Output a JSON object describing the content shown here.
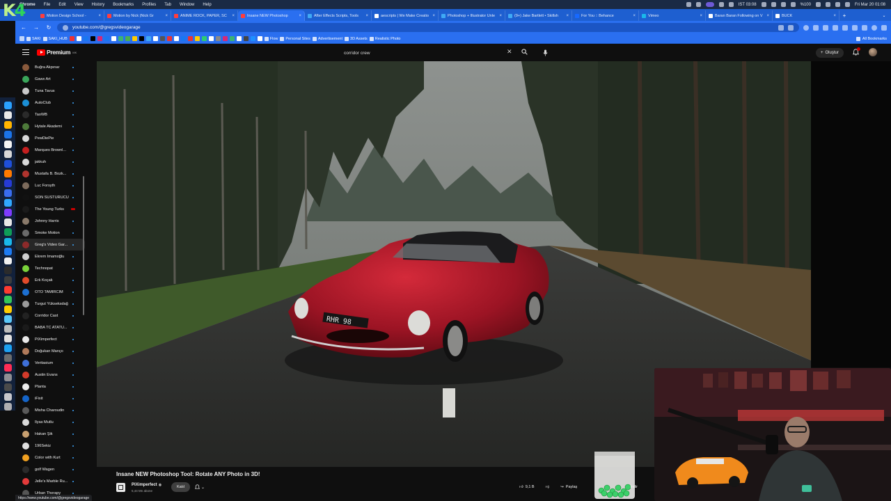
{
  "menubar": {
    "items": [
      "Chrome",
      "File",
      "Edit",
      "View",
      "History",
      "Bookmarks",
      "Profiles",
      "Tab",
      "Window",
      "Help"
    ],
    "status_left": "IST 03:08",
    "battery": "%100",
    "datetime": "Fri Mar 20  01:08"
  },
  "logo": {
    "text_k": "K",
    "text_4": "4"
  },
  "tabs": [
    {
      "title": "Motion Design School - ",
      "fav": "red"
    },
    {
      "title": "Motion by Nick (Nick Gr",
      "fav": "red"
    },
    {
      "title": "ANIME ROCK, PAPER, SC",
      "fav": "red"
    },
    {
      "title": "Insane NEW Photoshop",
      "fav": "red",
      "active": true
    },
    {
      "title": "After Effects Scripts, Tools",
      "fav": "globe"
    },
    {
      "title": "aescripts | We Make Creatio",
      "fav": "white"
    },
    {
      "title": "Photoshop + Illustrator Unle",
      "fav": "globe"
    },
    {
      "title": "(9+) Jake Bartlett • Skillsh",
      "fav": "globe"
    },
    {
      "title": "For You :: Behance",
      "fav": "behance"
    },
    {
      "title": "Vimeo",
      "fav": "vimeo"
    },
    {
      "title": "Baran Baran Following on V",
      "fav": "white"
    },
    {
      "title": "BUCK",
      "fav": "white"
    }
  ],
  "address": {
    "url": "youtube.com/@gregsvideogarage"
  },
  "bookmarks": {
    "items": [
      "SAKI",
      "SAKI_HUB",
      "Flow",
      "Personal Sites",
      "Advertisement",
      "3D Assets",
      "Realistic Photo"
    ],
    "all": "All Bookmarks"
  },
  "yt": {
    "logo_word": "Premium",
    "logo_sup": "MK",
    "search_query": "corridor crew",
    "create_label": "Oluştur"
  },
  "subscriptions": [
    {
      "name": "Buğra Akpınar",
      "color": "#8a5a3c"
    },
    {
      "name": "Gawx Art",
      "color": "#3aa55a"
    },
    {
      "name": "Tuna Tavus",
      "color": "#c9c9c9"
    },
    {
      "name": "AutoClub",
      "color": "#1b8fd6"
    },
    {
      "name": "TaoWB",
      "color": "#2a2a2a"
    },
    {
      "name": "Hytale Akademi",
      "color": "#4d7a3a"
    },
    {
      "name": "PewDiePie",
      "color": "#d8d8d8"
    },
    {
      "name": "Marques Brownl...",
      "color": "#c41f1f"
    },
    {
      "name": "jakkuh",
      "color": "#d8d8d8"
    },
    {
      "name": "Mustafa B. Bozk...",
      "color": "#b0342e"
    },
    {
      "name": "Luc Forsyth",
      "color": "#7d6b5c"
    },
    {
      "name": "SON SUSTURUCU",
      "color": "#111111"
    },
    {
      "name": "The Young Turks",
      "color": "#1a1a1a",
      "live": true
    },
    {
      "name": "Johnny Harris",
      "color": "#8a7a6a"
    },
    {
      "name": "Smoke Motion",
      "color": "#6a6a6a"
    },
    {
      "name": "Greg's Video Gar...",
      "color": "#8c2a2a",
      "hover": true
    },
    {
      "name": "Ekrem İmamoğlu",
      "color": "#cfcfcf"
    },
    {
      "name": "Technopat",
      "color": "#7ad23a"
    },
    {
      "name": "Erk Koçak",
      "color": "#e24b2a"
    },
    {
      "name": "OTO TAMIRCIM",
      "color": "#1c6fd1"
    },
    {
      "name": "Turgut Yükseksdağ",
      "color": "#9a9a9a"
    },
    {
      "name": "Corridor Cast",
      "color": "#222222"
    },
    {
      "name": "BABA TC ATATU...",
      "color": "#1a1a1a"
    },
    {
      "name": "PiXimperfect",
      "color": "#e8e8e8"
    },
    {
      "name": "Doğukan Manço",
      "color": "#b07a5a"
    },
    {
      "name": "Veritasium",
      "color": "#3e6fd8"
    },
    {
      "name": "Austin Evans",
      "color": "#d33a2a"
    },
    {
      "name": "Planta",
      "color": "#eeeeee"
    },
    {
      "name": "iFixit",
      "color": "#1464c8"
    },
    {
      "name": "Misha Charoudin",
      "color": "#5a5a5a"
    },
    {
      "name": "İlyas Mutlu",
      "color": "#d8d8d8"
    },
    {
      "name": "Hakan Şik",
      "color": "#c8a070"
    },
    {
      "name": "196Sekiz",
      "color": "#e0e0e0"
    },
    {
      "name": "Color with Kurt",
      "color": "#f0a020"
    },
    {
      "name": "golf Wagen",
      "color": "#2a2a2a"
    },
    {
      "name": "Jelle's Marble Ru...",
      "color": "#e33a3a"
    },
    {
      "name": "Urban Therapy",
      "color": "#555555"
    }
  ],
  "video": {
    "plate_text": "RHR 98",
    "title": "Insane NEW Photoshop Tool: Rotate ANY Photo in 3D!",
    "channel_name": "PiXimperfect",
    "verified": "◉",
    "subscribers": "5,44 Mn abone",
    "join_label": "Katıl",
    "likes": "9,1 B",
    "share_label": "Paylaş",
    "download_label": "İndir"
  },
  "status_url": "https://www.youtube.com/@gregsvideogarage",
  "colors": {
    "brand_red": "#ff0000",
    "chrome_blue": "#2a6ff0"
  }
}
